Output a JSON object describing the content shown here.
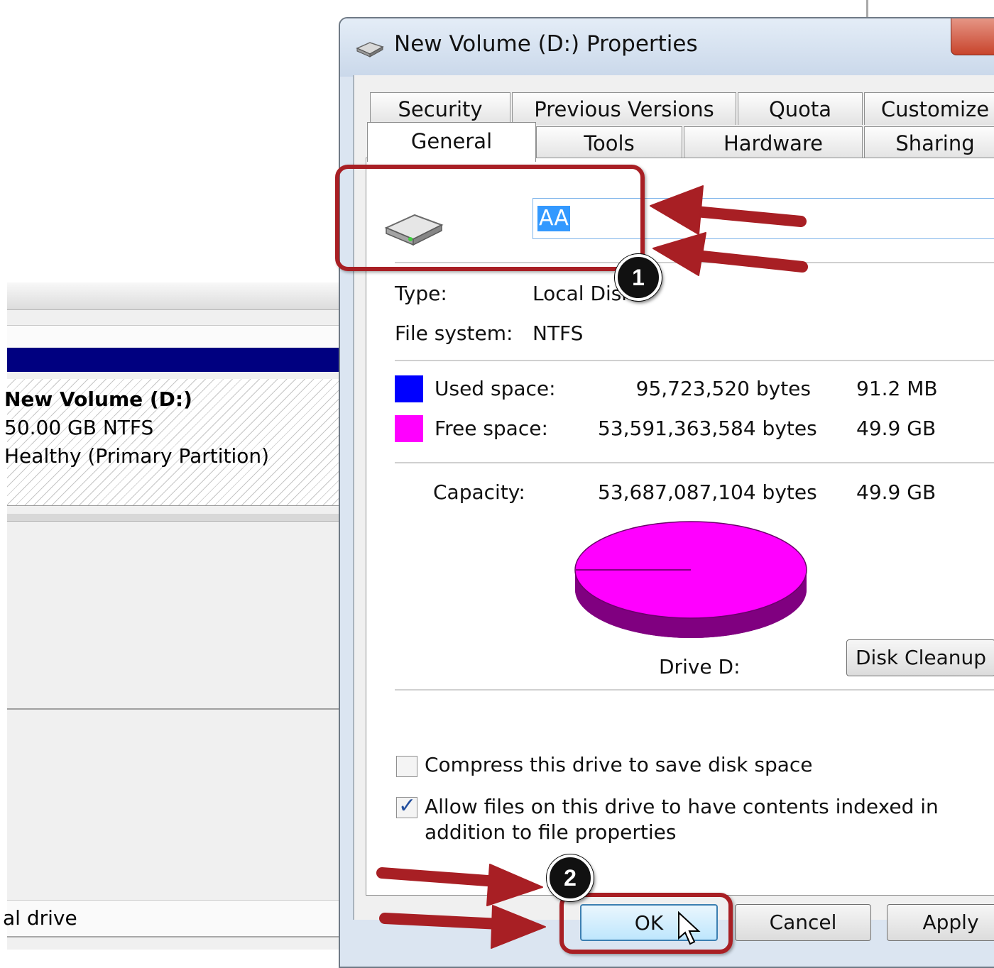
{
  "background_window": {
    "volume_name": "New Volume  (D:)",
    "volume_size": "50.00 GB NTFS",
    "volume_status": "Healthy (Primary Partition)",
    "footer_text": "al drive"
  },
  "dialog": {
    "title": "New Volume (D:) Properties",
    "tabs_row1": [
      "Security",
      "Previous Versions",
      "Quota",
      "Customize"
    ],
    "tabs_row2": [
      "General",
      "Tools",
      "Hardware",
      "Sharing"
    ],
    "active_tab": "General",
    "volume_label_value": "AA",
    "type_label": "Type:",
    "type_value": "Local Disk",
    "filesystem_label": "File system:",
    "filesystem_value": "NTFS",
    "used_label": "Used space:",
    "used_bytes": "95,723,520 bytes",
    "used_size": "91.2 MB",
    "used_color": "#0000ff",
    "free_label": "Free space:",
    "free_bytes": "53,591,363,584 bytes",
    "free_size": "49.9 GB",
    "free_color": "#ff00ff",
    "capacity_label": "Capacity:",
    "capacity_bytes": "53,687,087,104 bytes",
    "capacity_size": "49.9 GB",
    "drive_caption": "Drive D:",
    "disk_cleanup_label": "Disk Cleanup",
    "compress_label": "Compress this drive to save disk space",
    "compress_checked": false,
    "index_label": "Allow files on this drive to have contents indexed in addition to file properties",
    "index_checked": true,
    "ok_label": "OK",
    "cancel_label": "Cancel",
    "apply_label": "Apply"
  },
  "annotations": {
    "step1": "1",
    "step2": "2",
    "highlight_color": "#a81f24"
  }
}
